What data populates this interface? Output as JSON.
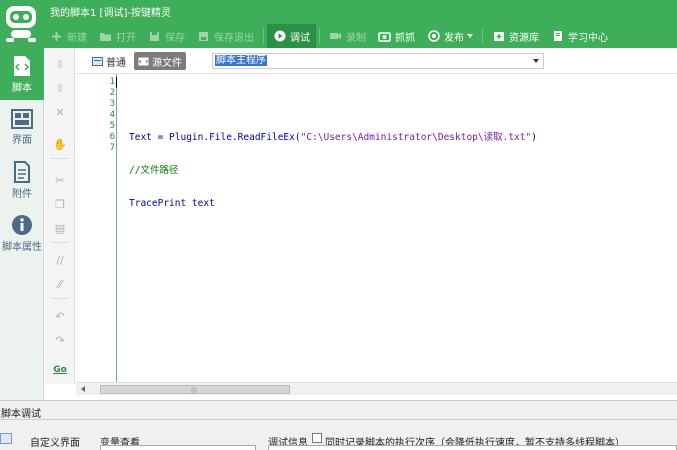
{
  "window": {
    "title": "我的脚本1 [调试]-按键精灵"
  },
  "toolbar": {
    "items": [
      {
        "label": "新建",
        "icon": "plus-icon",
        "enabled": false
      },
      {
        "label": "打开",
        "icon": "folder-icon",
        "enabled": false
      },
      {
        "label": "保存",
        "icon": "save-icon",
        "enabled": false
      },
      {
        "label": "保存退出",
        "icon": "save-exit-icon",
        "enabled": false
      },
      {
        "label": "调试",
        "icon": "play-icon",
        "enabled": true,
        "active": true
      },
      {
        "label": "录制",
        "icon": "record-icon",
        "enabled": false
      },
      {
        "label": "抓抓",
        "icon": "capture-icon",
        "enabled": true
      },
      {
        "label": "发布",
        "icon": "publish-icon",
        "enabled": true,
        "dropdown": true
      },
      {
        "label": "资源库",
        "icon": "resource-icon",
        "enabled": true
      },
      {
        "label": "学习中心",
        "icon": "book-icon",
        "enabled": true
      }
    ]
  },
  "sidebar": {
    "items": [
      {
        "label": "脚本",
        "icon": "script-icon",
        "active": true
      },
      {
        "label": "界面",
        "icon": "interface-icon",
        "active": false
      },
      {
        "label": "附件",
        "icon": "attachment-icon",
        "active": false
      },
      {
        "label": "脚本属性",
        "icon": "info-icon",
        "active": false
      }
    ]
  },
  "editor": {
    "modes": [
      {
        "label": "普通",
        "active": false
      },
      {
        "label": "源文件",
        "active": true
      }
    ],
    "subroutine_select": "脚本主程序",
    "line_numbers": [
      "1",
      "2",
      "3",
      "4",
      "5",
      "6",
      "7"
    ],
    "lines": [
      {
        "code": "",
        "comment": "",
        "str": ""
      },
      {
        "code_before": "Text = Plugin.File.ReadFileEx(",
        "str": "\"C:\\Users\\Administrator\\Desktop\\读取.txt\"",
        "code_after": ")"
      },
      {
        "comment": "//文件路径"
      },
      {
        "code_before": "TracePrint text"
      },
      {
        "code_before": ""
      },
      {
        "code_before": ""
      },
      {
        "code_before": ""
      }
    ]
  },
  "debug_panel": {
    "title": "脚本调试",
    "custom_ui_label": "自定义界面",
    "var_view_label": "变量查看",
    "debug_info_label": "调试信息",
    "record_order_label": "同时记录脚本的执行次序（会降低执行速度，暂不支持多线程脚本）"
  },
  "colors": {
    "brand_green": "#3fae5a",
    "line_number_green": "#2b8a3e",
    "code_blue": "#0000aa",
    "string_purple": "#7a1ca8",
    "comment_green": "#008000"
  }
}
